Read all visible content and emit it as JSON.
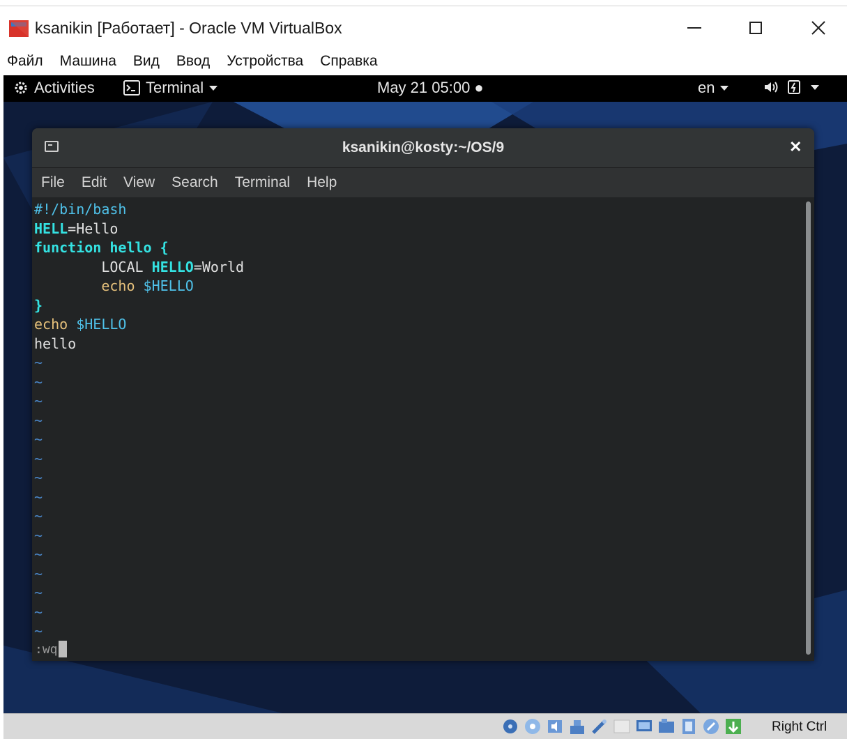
{
  "vbox": {
    "title": "ksanikin [Работает] - Oracle VM VirtualBox",
    "menu": [
      "Файл",
      "Машина",
      "Вид",
      "Ввод",
      "Устройства",
      "Справка"
    ],
    "host_key_label": "Right Ctrl"
  },
  "gnome": {
    "activities": "Activities",
    "app_menu": "Terminal",
    "clock": "May 21  05:00 ●",
    "lang": "en"
  },
  "terminal": {
    "title": "ksanikin@kosty:~/OS/9",
    "menu": [
      "File",
      "Edit",
      "View",
      "Search",
      "Terminal",
      "Help"
    ],
    "command_line": ":wq"
  },
  "script_lines": [
    [
      {
        "t": "#!/bin/bash",
        "c": "cyan"
      }
    ],
    [
      {
        "t": "HELL",
        "c": "cyanb"
      },
      {
        "t": "=Hello",
        "c": "plain"
      }
    ],
    [
      {
        "t": "function hello {",
        "c": "cyanb"
      }
    ],
    [
      {
        "t": "        LOCAL ",
        "c": "plain"
      },
      {
        "t": "HELLO",
        "c": "cyanb"
      },
      {
        "t": "=World",
        "c": "plain"
      }
    ],
    [
      {
        "t": "        echo ",
        "c": "yellow"
      },
      {
        "t": "$HELLO",
        "c": "cyan"
      }
    ],
    [
      {
        "t": "}",
        "c": "cyanb"
      }
    ],
    [
      {
        "t": "echo ",
        "c": "yellow"
      },
      {
        "t": "$HELLO",
        "c": "cyan"
      }
    ],
    [
      {
        "t": "hello",
        "c": "plain"
      }
    ]
  ],
  "empty_line_marker": "~",
  "empty_line_count": 15,
  "colors": {
    "desktop_bg": "#0d1a33",
    "top_bar": "#000000",
    "terminal_bg": "#222425",
    "syntax_cyan": "#4fc1e9",
    "syntax_keyword": "#34e2e2",
    "syntax_echo": "#e5c07b",
    "vim_tilde": "#4a86c8"
  }
}
